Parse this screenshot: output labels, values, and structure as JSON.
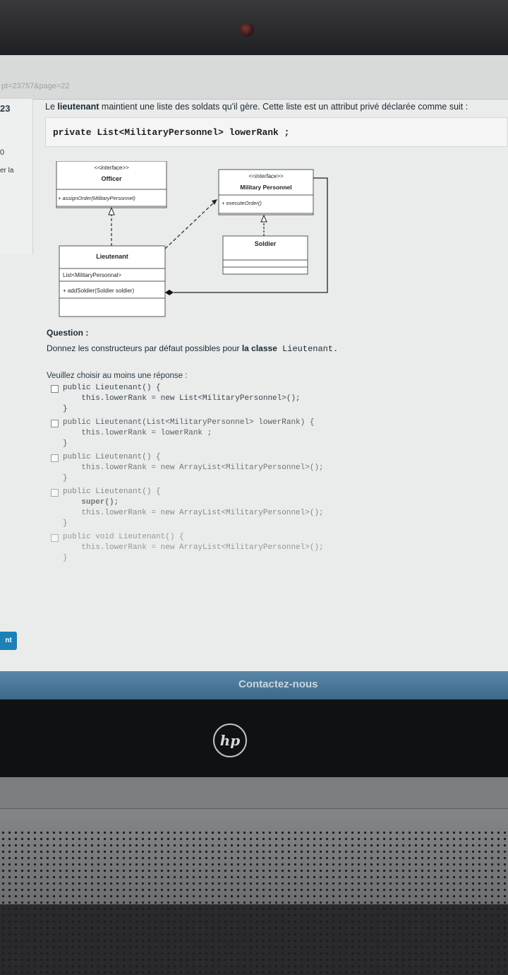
{
  "browser": {
    "url_fragment": "pt=23757&page=22"
  },
  "sidebar": {
    "question_number": "23",
    "zero": "0",
    "la_text": "er la",
    "nav_button": "nt"
  },
  "intro": {
    "part1": "Le ",
    "bold": "lieutenant",
    "part2": " maintient une liste des soldats qu'il gère. Cette liste est un attribut privé déclarée comme suit :"
  },
  "declaration": "private List<MilitaryPersonnel> lowerRank ;",
  "uml": {
    "officer": {
      "stereotype": "<<interface>>",
      "name": "Officer",
      "method": "+ assignOrder(MilitaryPersonnel)"
    },
    "military": {
      "stereotype": "<<interface>>",
      "name": "Military Personnel",
      "method": "+ executeOrder()"
    },
    "soldier": {
      "name": "Soldier"
    },
    "lieutenant": {
      "name": "Lieutenant",
      "attribute": "List<MilitaryPersonnal>",
      "method": "+ addSoldier(Soldier soldier)"
    }
  },
  "question": {
    "title": "Question :",
    "text_prefix": "Donnez les constructeurs par défaut possibles pour ",
    "text_bold": "la classe",
    "text_mono": " Lieutenant.",
    "instruction": "Veuillez choisir au moins une réponse :"
  },
  "options": [
    {
      "lines": [
        "public Lieutenant() {",
        "    this.lowerRank = new List<MilitaryPersonnel>();",
        "}"
      ]
    },
    {
      "lines": [
        "public Lieutenant(List<MilitaryPersonnel> lowerRank) {",
        "    this.lowerRank = lowerRank ;",
        "}"
      ]
    },
    {
      "lines": [
        "public Lieutenant() {",
        "    this.lowerRank = new ArrayList<MilitaryPersonnel>();",
        "}"
      ]
    },
    {
      "lines": [
        "public Lieutenant() {",
        "    super();",
        "    this.lowerRank = new ArrayList<MilitaryPersonnel>();",
        "}"
      ]
    },
    {
      "lines": [
        "public void Lieutenant() {",
        "    this.lowerRank = new ArrayList<MilitaryPersonnel>();",
        "}"
      ]
    }
  ],
  "footer": {
    "contact": "Contactez-nous"
  },
  "laptop": {
    "brand": "hp"
  }
}
